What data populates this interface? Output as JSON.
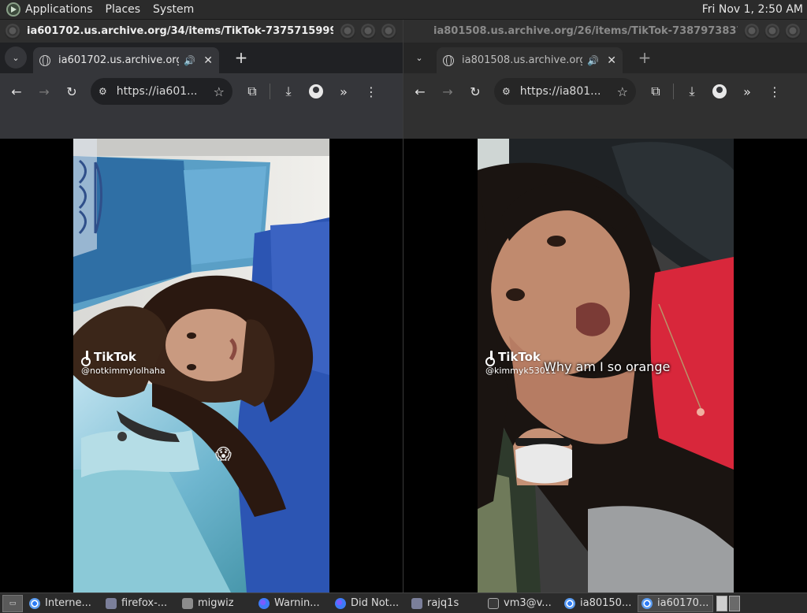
{
  "top_panel": {
    "menus": [
      "Applications",
      "Places",
      "System"
    ],
    "clock": "Fri Nov  1,  2:50 AM"
  },
  "windows": [
    {
      "title": "ia601702.us.archive.org/34/items/TikTok-737571599941430...",
      "active": true,
      "tab_title": "ia601702.us.archive.org/34/items/TikTok",
      "url": "https://ia601...",
      "video": {
        "watermark_logo": "TikTok",
        "watermark_handle": "@notkimmylolhaha",
        "caption": "",
        "emoji": "😱"
      }
    },
    {
      "title": "ia801508.us.archive.org/26/items/TikTok-738797383789324...",
      "active": false,
      "tab_title": "ia801508.us.archive.org/26/items/TikTok",
      "url": "https://ia801...",
      "video": {
        "watermark_logo": "TikTok",
        "watermark_handle": "@kimmyk53011",
        "caption": "Why am I so orange",
        "emoji": ""
      }
    }
  ],
  "taskbar": {
    "tasks": [
      {
        "label": "Interne...",
        "icon": "chrome",
        "active": false
      },
      {
        "label": "firefox-...",
        "icon": "app",
        "active": false
      },
      {
        "label": "migwiz",
        "icon": "folder",
        "active": false
      },
      {
        "label": "Warnin...",
        "icon": "firefox",
        "active": false
      },
      {
        "label": "Did Not...",
        "icon": "firefox",
        "active": false
      },
      {
        "label": "rajq1s",
        "icon": "app",
        "active": false
      },
      {
        "label": "vm3@v...",
        "icon": "term",
        "active": false
      },
      {
        "label": "ia80150...",
        "icon": "chrome",
        "active": false
      },
      {
        "label": "ia60170...",
        "icon": "chrome",
        "active": true
      }
    ]
  }
}
